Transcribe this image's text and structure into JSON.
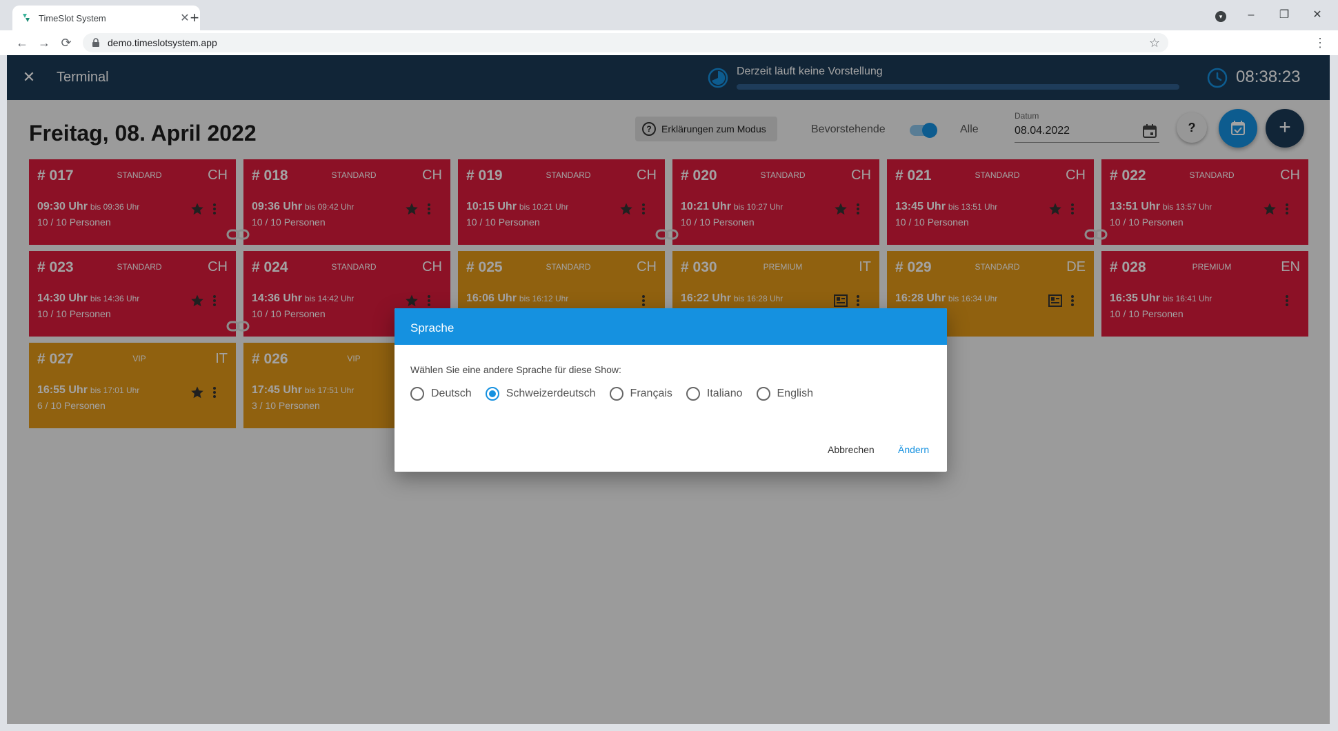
{
  "browser": {
    "tab_title": "TimeSlot System",
    "tab_close": "✕",
    "new_tab": "+",
    "url": "demo.timeslotsystem.app",
    "back": "←",
    "forward": "→",
    "reload": "⟳",
    "bookmark": "☆",
    "menu": "⋮",
    "minimize": "–",
    "maximize": "❐",
    "close": "✕",
    "profile": "▾"
  },
  "header": {
    "close_symbol": "✕",
    "title": "Terminal",
    "status": "Derzeit läuft keine Vorstellung",
    "time": "08:38:23"
  },
  "toolbar": {
    "heading": "Freitag, 08. April 2022",
    "explain_label": "Erklärungen zum Modus",
    "explain_q": "?",
    "toggle_left": "Bevorstehende",
    "toggle_right": "Alle",
    "toggle_on": true,
    "date_label": "Datum",
    "date_value": "08.04.2022",
    "help": "?",
    "add": "+"
  },
  "cards": [
    {
      "num": "# 017",
      "type": "STANDARD",
      "lang": "CH",
      "time": "09:30 Uhr",
      "until": "bis 09:36 Uhr",
      "people": "10 / 10 Personen",
      "color": "red",
      "icon": "star"
    },
    {
      "num": "# 018",
      "type": "STANDARD",
      "lang": "CH",
      "time": "09:36 Uhr",
      "until": "bis 09:42 Uhr",
      "people": "10 / 10 Personen",
      "color": "red",
      "icon": "star"
    },
    {
      "num": "# 019",
      "type": "STANDARD",
      "lang": "CH",
      "time": "10:15 Uhr",
      "until": "bis 10:21 Uhr",
      "people": "10 / 10 Personen",
      "color": "red",
      "icon": "star"
    },
    {
      "num": "# 020",
      "type": "STANDARD",
      "lang": "CH",
      "time": "10:21 Uhr",
      "until": "bis 10:27 Uhr",
      "people": "10 / 10 Personen",
      "color": "red",
      "icon": "star"
    },
    {
      "num": "# 021",
      "type": "STANDARD",
      "lang": "CH",
      "time": "13:45 Uhr",
      "until": "bis 13:51 Uhr",
      "people": "10 / 10 Personen",
      "color": "red",
      "icon": "star"
    },
    {
      "num": "# 022",
      "type": "STANDARD",
      "lang": "CH",
      "time": "13:51 Uhr",
      "until": "bis 13:57 Uhr",
      "people": "10 / 10 Personen",
      "color": "red",
      "icon": "star"
    },
    {
      "num": "# 023",
      "type": "STANDARD",
      "lang": "CH",
      "time": "14:30 Uhr",
      "until": "bis 14:36 Uhr",
      "people": "10 / 10 Personen",
      "color": "red",
      "icon": "star"
    },
    {
      "num": "# 024",
      "type": "STANDARD",
      "lang": "CH",
      "time": "14:36 Uhr",
      "until": "bis 14:42 Uhr",
      "people": "10 / 10 Personen",
      "color": "red",
      "icon": "star"
    },
    {
      "num": "# 025",
      "type": "STANDARD",
      "lang": "CH",
      "time": "16:06 Uhr",
      "until": "bis 16:12 Uhr",
      "people": "",
      "color": "orange",
      "icon": "none"
    },
    {
      "num": "# 030",
      "type": "PREMIUM",
      "lang": "IT",
      "time": "16:22 Uhr",
      "until": "bis 16:28 Uhr",
      "people": "",
      "color": "orange",
      "icon": "doc"
    },
    {
      "num": "# 029",
      "type": "STANDARD",
      "lang": "DE",
      "time": "16:28 Uhr",
      "until": "bis 16:34 Uhr",
      "people": "nen",
      "color": "orange",
      "icon": "doc"
    },
    {
      "num": "# 028",
      "type": "PREMIUM",
      "lang": "EN",
      "time": "16:35 Uhr",
      "until": "bis 16:41 Uhr",
      "people": "10 / 10 Personen",
      "color": "red",
      "icon": "none"
    },
    {
      "num": "# 027",
      "type": "VIP",
      "lang": "IT",
      "time": "16:55 Uhr",
      "until": "bis 17:01 Uhr",
      "people": "6 / 10 Personen",
      "color": "orange",
      "icon": "star"
    },
    {
      "num": "# 026",
      "type": "VIP",
      "lang": "",
      "time": "17:45 Uhr",
      "until": "bis 17:51 Uhr",
      "people": "3 / 10 Personen",
      "color": "orange",
      "icon": "none"
    }
  ],
  "dialog": {
    "title": "Sprache",
    "question": "Wählen Sie eine andere Sprache für diese Show:",
    "options": [
      {
        "label": "Deutsch",
        "checked": false
      },
      {
        "label": "Schweizerdeutsch",
        "checked": true
      },
      {
        "label": "Français",
        "checked": false
      },
      {
        "label": "Italiano",
        "checked": false
      },
      {
        "label": "English",
        "checked": false
      }
    ],
    "cancel": "Abbrechen",
    "ok": "Ändern"
  },
  "colors": {
    "header": "#1b3a57",
    "accent": "#1591e0",
    "card_red": "#dc1b3c",
    "card_orange": "#e29818"
  }
}
